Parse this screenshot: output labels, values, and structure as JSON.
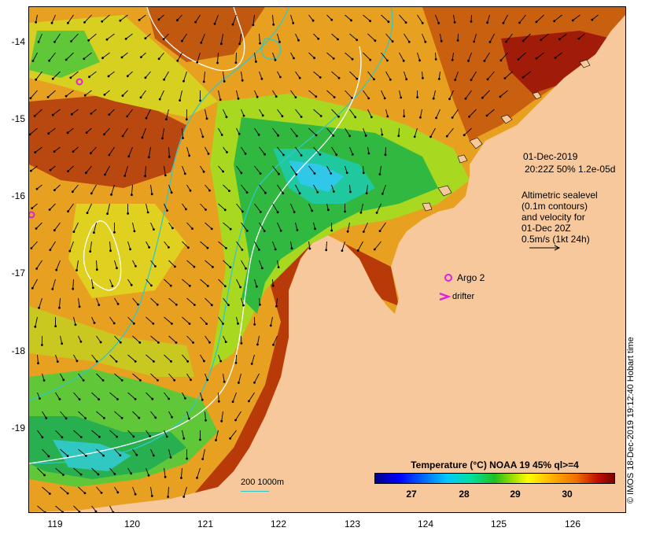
{
  "map": {
    "lat_ticks": [
      "-14",
      "-15",
      "-16",
      "-17",
      "-18",
      "-19"
    ],
    "lon_ticks": [
      "119",
      "120",
      "121",
      "122",
      "123",
      "124",
      "125",
      "126"
    ]
  },
  "info": {
    "date": "01-Dec-2019",
    "time_line": "20:22Z  50% 1.2e-05d",
    "altimetry_lines": [
      "Altimetric sealevel",
      "(0.1m contours)",
      "and velocity for",
      "01-Dec 20Z",
      "0.5m/s (1kt 24h)"
    ]
  },
  "markers": {
    "argo_label": "Argo 2",
    "drifter_label": "drifter"
  },
  "legend": {
    "title": "Temperature (°C) NOAA 19 45% ql>=4",
    "ticks": [
      "27",
      "28",
      "29",
      "30"
    ],
    "depth_text": "200  1000m"
  },
  "credit": "© IMOS 18-Dec-2019 19:12:40 Hobart time",
  "colors": {
    "land": "#f7c89b",
    "depth_contour_200m": "#30c8c8",
    "depth_contour_1000m": "#ffffff",
    "marker": "#e020e0"
  }
}
